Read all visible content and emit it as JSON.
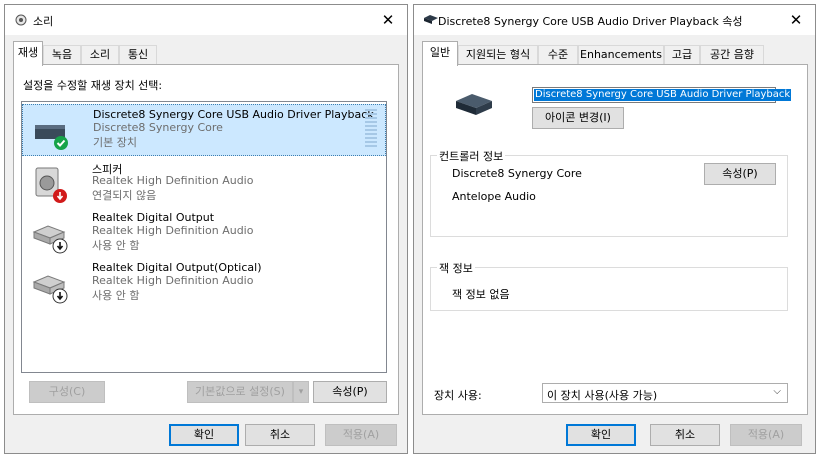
{
  "sound_dialog": {
    "title": "소리",
    "tabs": [
      "재생",
      "녹음",
      "소리",
      "통신"
    ],
    "instruction": "설정을 수정할 재생 장치 선택:",
    "devices": [
      {
        "name": "Discrete8 Synergy Core USB Audio Driver Playback",
        "line2": "Discrete8 Synergy Core",
        "line3": "기본 장치",
        "status": "default"
      },
      {
        "name": "스피커",
        "line2": "Realtek High Definition Audio",
        "line3": "연결되지 않음",
        "status": "disconnected"
      },
      {
        "name": "Realtek Digital Output",
        "line2": "Realtek High Definition Audio",
        "line3": "사용 안 함",
        "status": "disabled"
      },
      {
        "name": "Realtek Digital Output(Optical)",
        "line2": "Realtek High Definition Audio",
        "line3": "사용 안 함",
        "status": "disabled"
      }
    ],
    "configure_label": "구성(C)",
    "set_default_label": "기본값으로 설정(S)",
    "properties_label": "속성(P)",
    "ok_label": "확인",
    "cancel_label": "취소",
    "apply_label": "적용(A)"
  },
  "props_dialog": {
    "title": "Discrete8 Synergy Core USB Audio Driver Playback 속성",
    "tabs": [
      "일반",
      "지원되는 형식",
      "수준",
      "Enhancements",
      "고급",
      "공간 음향"
    ],
    "device_name": "Discrete8 Synergy Core USB Audio Driver Playback",
    "change_icon_label": "아이콘 변경(I)",
    "controller_group_label": "컨트롤러 정보",
    "controller_name": "Discrete8 Synergy Core",
    "controller_vendor": "Antelope Audio",
    "controller_properties_label": "속성(P)",
    "jack_group_label": "잭 정보",
    "jack_value": "잭 정보 없음",
    "device_usage_label": "장치 사용:",
    "device_usage_value": "이 장치 사용(사용 가능)",
    "ok_label": "확인",
    "cancel_label": "취소",
    "apply_label": "적용(A)"
  },
  "colors": {
    "selection": "#cce8ff",
    "accent": "#0078d7",
    "badge_ok": "#16a34a",
    "badge_error": "#d11a1a"
  }
}
